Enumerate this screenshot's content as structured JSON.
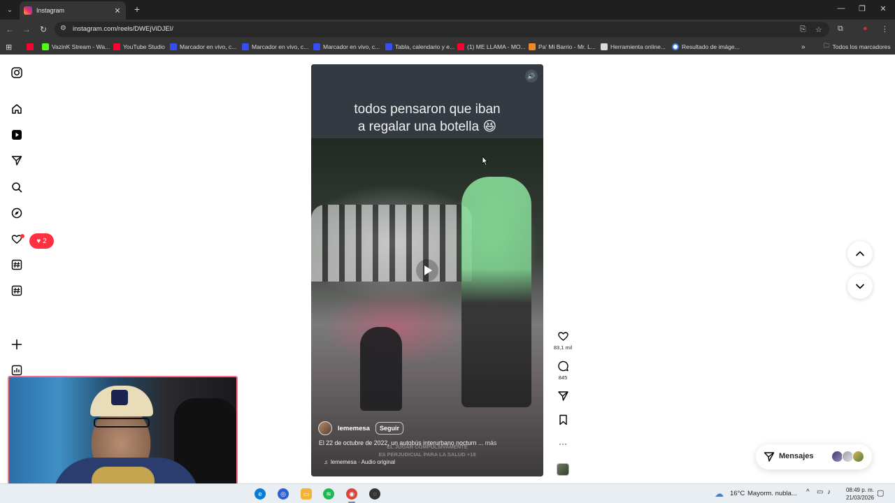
{
  "browser": {
    "tab_title": "Instagram",
    "url": "instagram.com/reels/DWEjViDJEI/",
    "bookmarks": [
      {
        "label": "",
        "icon": "youtube-icon",
        "color": "#ff0033"
      },
      {
        "label": "VazinK Stream - Wa...",
        "icon": "kick-icon",
        "color": "#53fc18"
      },
      {
        "label": "YouTube Studio",
        "icon": "youtube-icon",
        "color": "#ff0033"
      },
      {
        "label": "Marcador en vivo, c...",
        "icon": "sofascore-icon",
        "color": "#374df5"
      },
      {
        "label": "Marcador en vivo, c...",
        "icon": "sofascore-icon",
        "color": "#374df5"
      },
      {
        "label": "Marcador en vivo, c...",
        "icon": "sofascore-icon",
        "color": "#374df5"
      },
      {
        "label": "Tabla, calendario y e...",
        "icon": "sofascore-icon",
        "color": "#374df5"
      },
      {
        "label": "(1) ME LLAMA - MO...",
        "icon": "youtube-icon",
        "color": "#ff0033"
      },
      {
        "label": "Pa' Mi Barrio - Mr. L...",
        "icon": "genius-icon",
        "color": "#f08a24"
      },
      {
        "label": "Herramienta online...",
        "icon": "tool-icon",
        "color": "#d9d9d9"
      },
      {
        "label": "Resultado de imáge...",
        "icon": "google-icon",
        "color": "#ffffff"
      }
    ],
    "all_bookmarks": "Todos los marcadores"
  },
  "instagram": {
    "notifications_count": "2",
    "reel": {
      "caption_line1": "todos pensaron que iban",
      "caption_line2": "a regalar una botella 😆",
      "author": "lememesa",
      "follow_label": "Seguir",
      "description": "El 22 de octubre de 2022, un autobús interurbano nocturn ...",
      "more_label": "más",
      "overlay_line1": "EL JUGAR COMPULSIVAMENTE",
      "overlay_line2": "ES PERJUDICIAL PARA LA SALUD +18",
      "audio": "lememesa · Audio original",
      "likes": "83,1 mil",
      "comments": "845"
    },
    "messages_label": "Mensajes"
  },
  "taskbar": {
    "weather": "16°C",
    "weather_desc": "Mayorm. nubla...",
    "time": "08:49 p. m.",
    "date": "21/03/2026"
  },
  "colors": {
    "ig_red": "#ff3040",
    "chrome_dark": "#353535",
    "webcam_border": "#ff6b84"
  }
}
